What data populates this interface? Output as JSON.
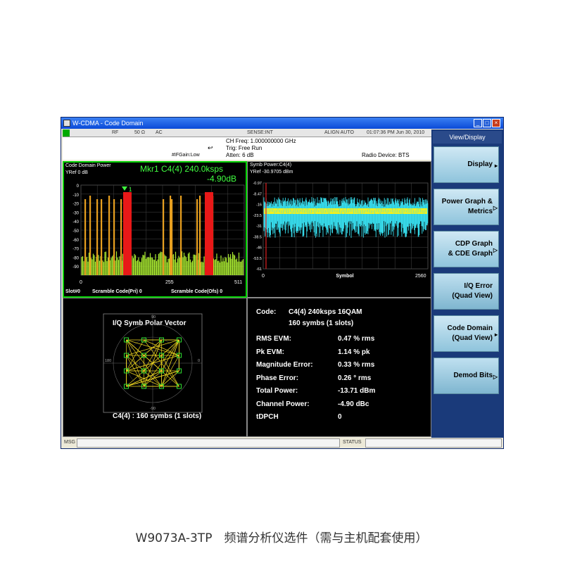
{
  "window": {
    "title": "W-CDMA - Code Domain",
    "controls": [
      "_",
      "□",
      "×"
    ]
  },
  "status_row": {
    "mode": "RF",
    "impedance": "50 Ω",
    "coupling": "AC",
    "sense": "SENSE:INT",
    "align": "ALIGN AUTO",
    "datetime": "01:07:36 PM Jun 30, 2010"
  },
  "info": {
    "ch_freq": "CH Freq: 1.000000000 GHz",
    "trig": "Trig: Free Run",
    "atten": "Atten: 6 dB",
    "ifgain": "#IFGain:Low",
    "radio_device": "Radio Device: BTS"
  },
  "cdp_panel": {
    "title": "Code Domain Power",
    "yref": "YRef  0 dB",
    "marker_line1": "Mkr1 C4(4) 240.0ksps",
    "marker_line2": "-4.90dB",
    "marker_label": "1",
    "y_ticks": [
      "0",
      "-10",
      "-20",
      "-30",
      "-40",
      "-50",
      "-60",
      "-70",
      "-80",
      "-90"
    ],
    "x_ticks": [
      "0",
      "255",
      "511"
    ],
    "footer_slot": "Slot#0",
    "footer_pri": "Scramble Code(Pri) 0",
    "footer_ofs": "Scramble Code(Ofs) 0"
  },
  "symb_panel": {
    "title": "Symb Power:C4(4)",
    "yref": "YRef  -30.9705 dBm",
    "y_ticks": [
      "-0.97",
      "-8.47",
      "-16",
      "-23.5",
      "-31",
      "-38.5",
      "-46",
      "-53.5",
      "-61"
    ],
    "x_ticks": [
      "0",
      "Symbol",
      "2560"
    ]
  },
  "iq_panel": {
    "title": "I/Q Symb Polar Vector",
    "caption": "C4(4) : 160 symbs (1 slots)",
    "axis_labels": [
      "0",
      "180",
      "90",
      "-90"
    ]
  },
  "metrics_panel": {
    "code_label": "Code:",
    "code_value": "C4(4) 240ksps 16QAM",
    "symbs": "160 symbs (1 slots)",
    "rows": [
      {
        "label": "RMS EVM:",
        "value": "0.47 % rms"
      },
      {
        "label": "Pk EVM:",
        "value": "1.14 % pk"
      },
      {
        "label": "Magnitude Error:",
        "value": "0.33 % rms"
      },
      {
        "label": "Phase Error:",
        "value": "0.26 ° rms"
      },
      {
        "label": "Total Power:",
        "value": "-13.71 dBm"
      },
      {
        "label": "Channel Power:",
        "value": "-4.90 dBc"
      },
      {
        "label": "tDPCH",
        "value": "0"
      }
    ]
  },
  "softkeys": {
    "header": "View/Display",
    "items": [
      {
        "line1": "Display",
        "line2": "",
        "arrow": "▸"
      },
      {
        "line1": "Power Graph &",
        "line2": "Metrics",
        "arrow": "▷"
      },
      {
        "line1": "CDP Graph",
        "line2": "& CDE Graph",
        "arrow": "▷"
      },
      {
        "line1": "I/Q Error",
        "line2": "(Quad View)",
        "arrow": ""
      },
      {
        "line1": "Code Domain",
        "line2": "(Quad View)",
        "arrow": "▸"
      },
      {
        "line1": "Demod Bits",
        "line2": "",
        "arrow": "▷"
      }
    ]
  },
  "bottom_bar": {
    "msg": "MSG",
    "status": "STATUS"
  },
  "caption": "W9073A-3TP　频谱分析仪选件（需与主机配套使用）",
  "colors": {
    "trace_green": "#a8e830",
    "bar_orange": "#e8a020",
    "bar_red": "#e81818",
    "symb_cyan": "#38e0f0",
    "symb_yellow": "#f0f020",
    "iq_yellow": "#e8d020",
    "iq_green": "#30e030"
  }
}
